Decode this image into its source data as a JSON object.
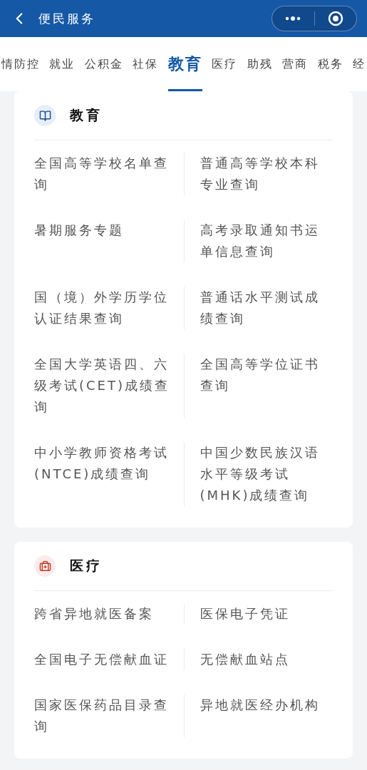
{
  "header": {
    "title": "便民服务"
  },
  "tabs": [
    {
      "label": "情防控",
      "selected": false
    },
    {
      "label": "就业",
      "selected": false
    },
    {
      "label": "公积金",
      "selected": false
    },
    {
      "label": "社保",
      "selected": false
    },
    {
      "label": "教育",
      "selected": true
    },
    {
      "label": "医疗",
      "selected": false
    },
    {
      "label": "助残",
      "selected": false
    },
    {
      "label": "营商",
      "selected": false
    },
    {
      "label": "税务",
      "selected": false
    },
    {
      "label": "经",
      "selected": false
    }
  ],
  "sections": [
    {
      "kind": "education",
      "title": "教育",
      "items": [
        "全国高等学校名单查询",
        "普通高等学校本科专业查询",
        "暑期服务专题",
        "高考录取通知书运单信息查询",
        "国（境）外学历学位认证结果查询",
        "普通话水平测试成绩查询",
        "全国大学英语四、六级考试(CET)成绩查询",
        "全国高等学位证书查询",
        "中小学教师资格考试(NTCE)成绩查询",
        "中国少数民族汉语水平等级考试(MHK)成绩查询"
      ]
    },
    {
      "kind": "medical",
      "title": "医疗",
      "items": [
        "跨省异地就医备案",
        "医保电子凭证",
        "全国电子无偿献血证",
        "无偿献血站点",
        "国家医保药品目录查询",
        "异地就医经办机构"
      ]
    }
  ]
}
